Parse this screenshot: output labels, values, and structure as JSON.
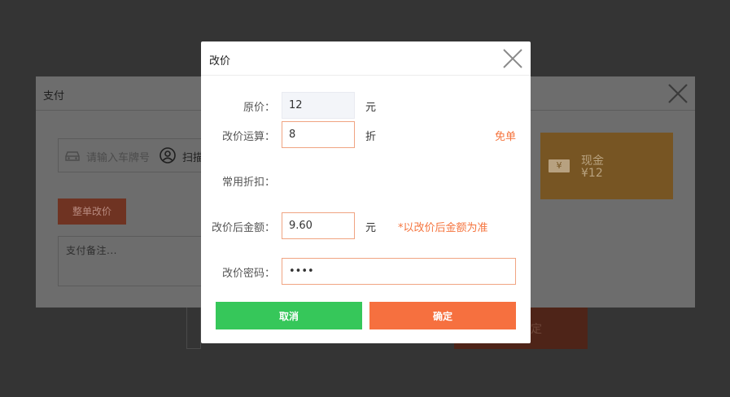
{
  "background_window": {
    "title": "支付",
    "plate_placeholder": "请输入车牌号",
    "scan_label": "扫描",
    "whole_order_button": "整单改价",
    "remark_placeholder": "支付备注...",
    "cash": {
      "label": "现金",
      "amount": "¥12",
      "icon_glyph": "¥"
    },
    "lower_button_fragment": "定"
  },
  "modal": {
    "title": "改价",
    "original_price": {
      "label": "原价：",
      "value": "12",
      "unit": "元"
    },
    "discount_op": {
      "label": "改价运算：",
      "value": "8",
      "unit": "折",
      "free_link": "免单"
    },
    "common_discount": {
      "label": "常用折扣："
    },
    "final_amount": {
      "label": "改价后金额：",
      "value": "9.60",
      "unit": "元",
      "note": "*以改价后金额为准"
    },
    "password": {
      "label": "改价密码：",
      "value": "1234"
    },
    "buttons": {
      "cancel": "取消",
      "confirm": "确定"
    }
  },
  "colors": {
    "overlay": "#343434",
    "accent_orange": "#f6703f",
    "cancel_green": "#36c75a",
    "input_border": "#f0a482"
  }
}
